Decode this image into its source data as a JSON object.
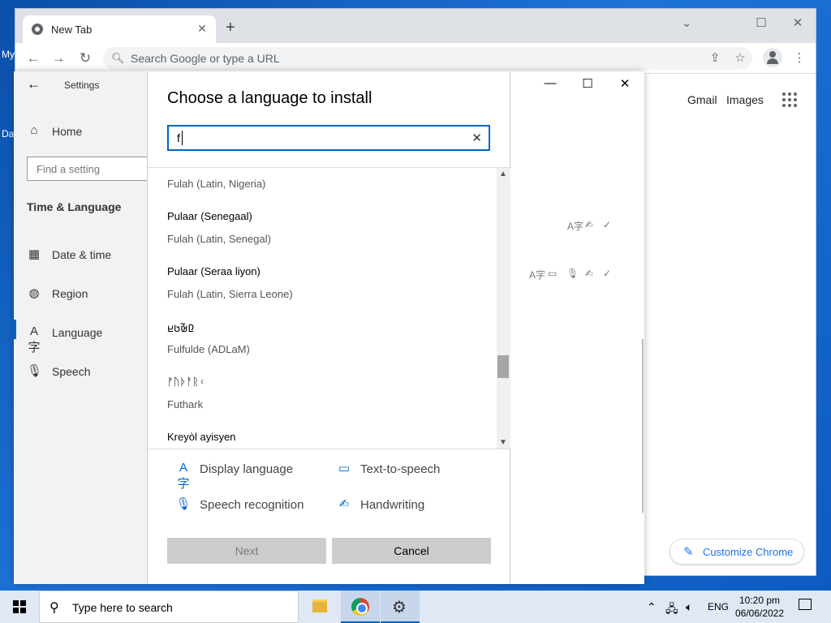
{
  "desktop": {
    "label_1": "My",
    "label_2": "Da"
  },
  "browser": {
    "tab_title": "New Tab",
    "tab_close": "✕",
    "new_tab": "+",
    "minimize": "⌄",
    "restore": "☐",
    "close": "✕",
    "omnibox_placeholder": "Search Google or type a URL",
    "gmail": "Gmail",
    "images": "Images",
    "customize": "Customize Chrome"
  },
  "settings": {
    "title": "Settings",
    "search_placeholder": "Find a setting",
    "home": "Home",
    "section": "Time & Language",
    "nav": [
      {
        "label": "Date & time",
        "icon": "date-time-icon"
      },
      {
        "label": "Region",
        "icon": "region-icon"
      },
      {
        "label": "Language",
        "icon": "language-icon"
      },
      {
        "label": "Speech",
        "icon": "microphone-icon"
      }
    ],
    "selected": "Language"
  },
  "dialog": {
    "title": "Choose a language to install",
    "search_value": "f",
    "languages": [
      {
        "native": "",
        "english": "Fulah (Latin, Nigeria)"
      },
      {
        "native": "Pulaar (Senegaal)",
        "english": "Fulah (Latin, Senegal)"
      },
      {
        "native": "Pulaar (Seraa liyon)",
        "english": "Fulah (Latin, Sierra Leone)"
      },
      {
        "native": "𞤆𞤵𞥄𞤢𞤪",
        "english": "Fulfulde (ADLaM)"
      },
      {
        "native": "ᚠᚢᚦᚨᚱᚲ",
        "english": "Futhark"
      },
      {
        "native": "Kreyòl ayisyen",
        "english": ""
      }
    ],
    "legend": {
      "display_language": "Display language",
      "text_to_speech": "Text-to-speech",
      "speech_recognition": "Speech recognition",
      "handwriting": "Handwriting"
    },
    "next": "Next",
    "cancel": "Cancel"
  },
  "taskbar": {
    "search_placeholder": "Type here to search",
    "language": "ENG",
    "time": "10:20 pm",
    "date": "06/06/2022"
  }
}
